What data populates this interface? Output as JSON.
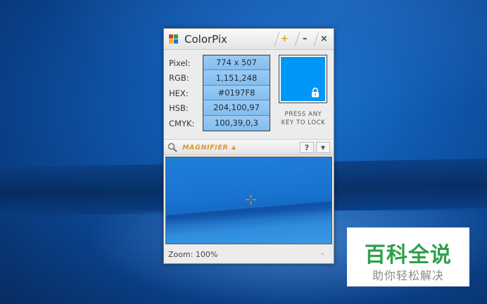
{
  "window": {
    "title": "ColorPix",
    "buttons": {
      "pin": "+",
      "minimize": "–",
      "close": "×"
    }
  },
  "labels": [
    "Pixel:",
    "RGB:",
    "HEX:",
    "HSB:",
    "CMYK:"
  ],
  "values": {
    "pixel": "774 x 507",
    "rgb": "1,151,248",
    "hex": "#0197F8",
    "hsb": "204,100,97",
    "cmyk": "100,39,0,3"
  },
  "swatch": {
    "color": "#0197F8",
    "icon": "lock-icon"
  },
  "lock_hint": {
    "line1": "PRESS ANY",
    "line2": "KEY TO LOCK"
  },
  "magnifier": {
    "label": "MAGNIFIER",
    "arrow": "▲",
    "help": "?",
    "dropdown": "▼",
    "zoom": "Zoom: 100%",
    "accent": "#E0982A"
  },
  "logo_colors": [
    "#d93a2b",
    "#2fa34a",
    "#f0b429",
    "#2d6fd0"
  ],
  "watermark": {
    "title": "百科全说",
    "subtitle": "助你轻松解决",
    "color": "#2DA14A"
  }
}
